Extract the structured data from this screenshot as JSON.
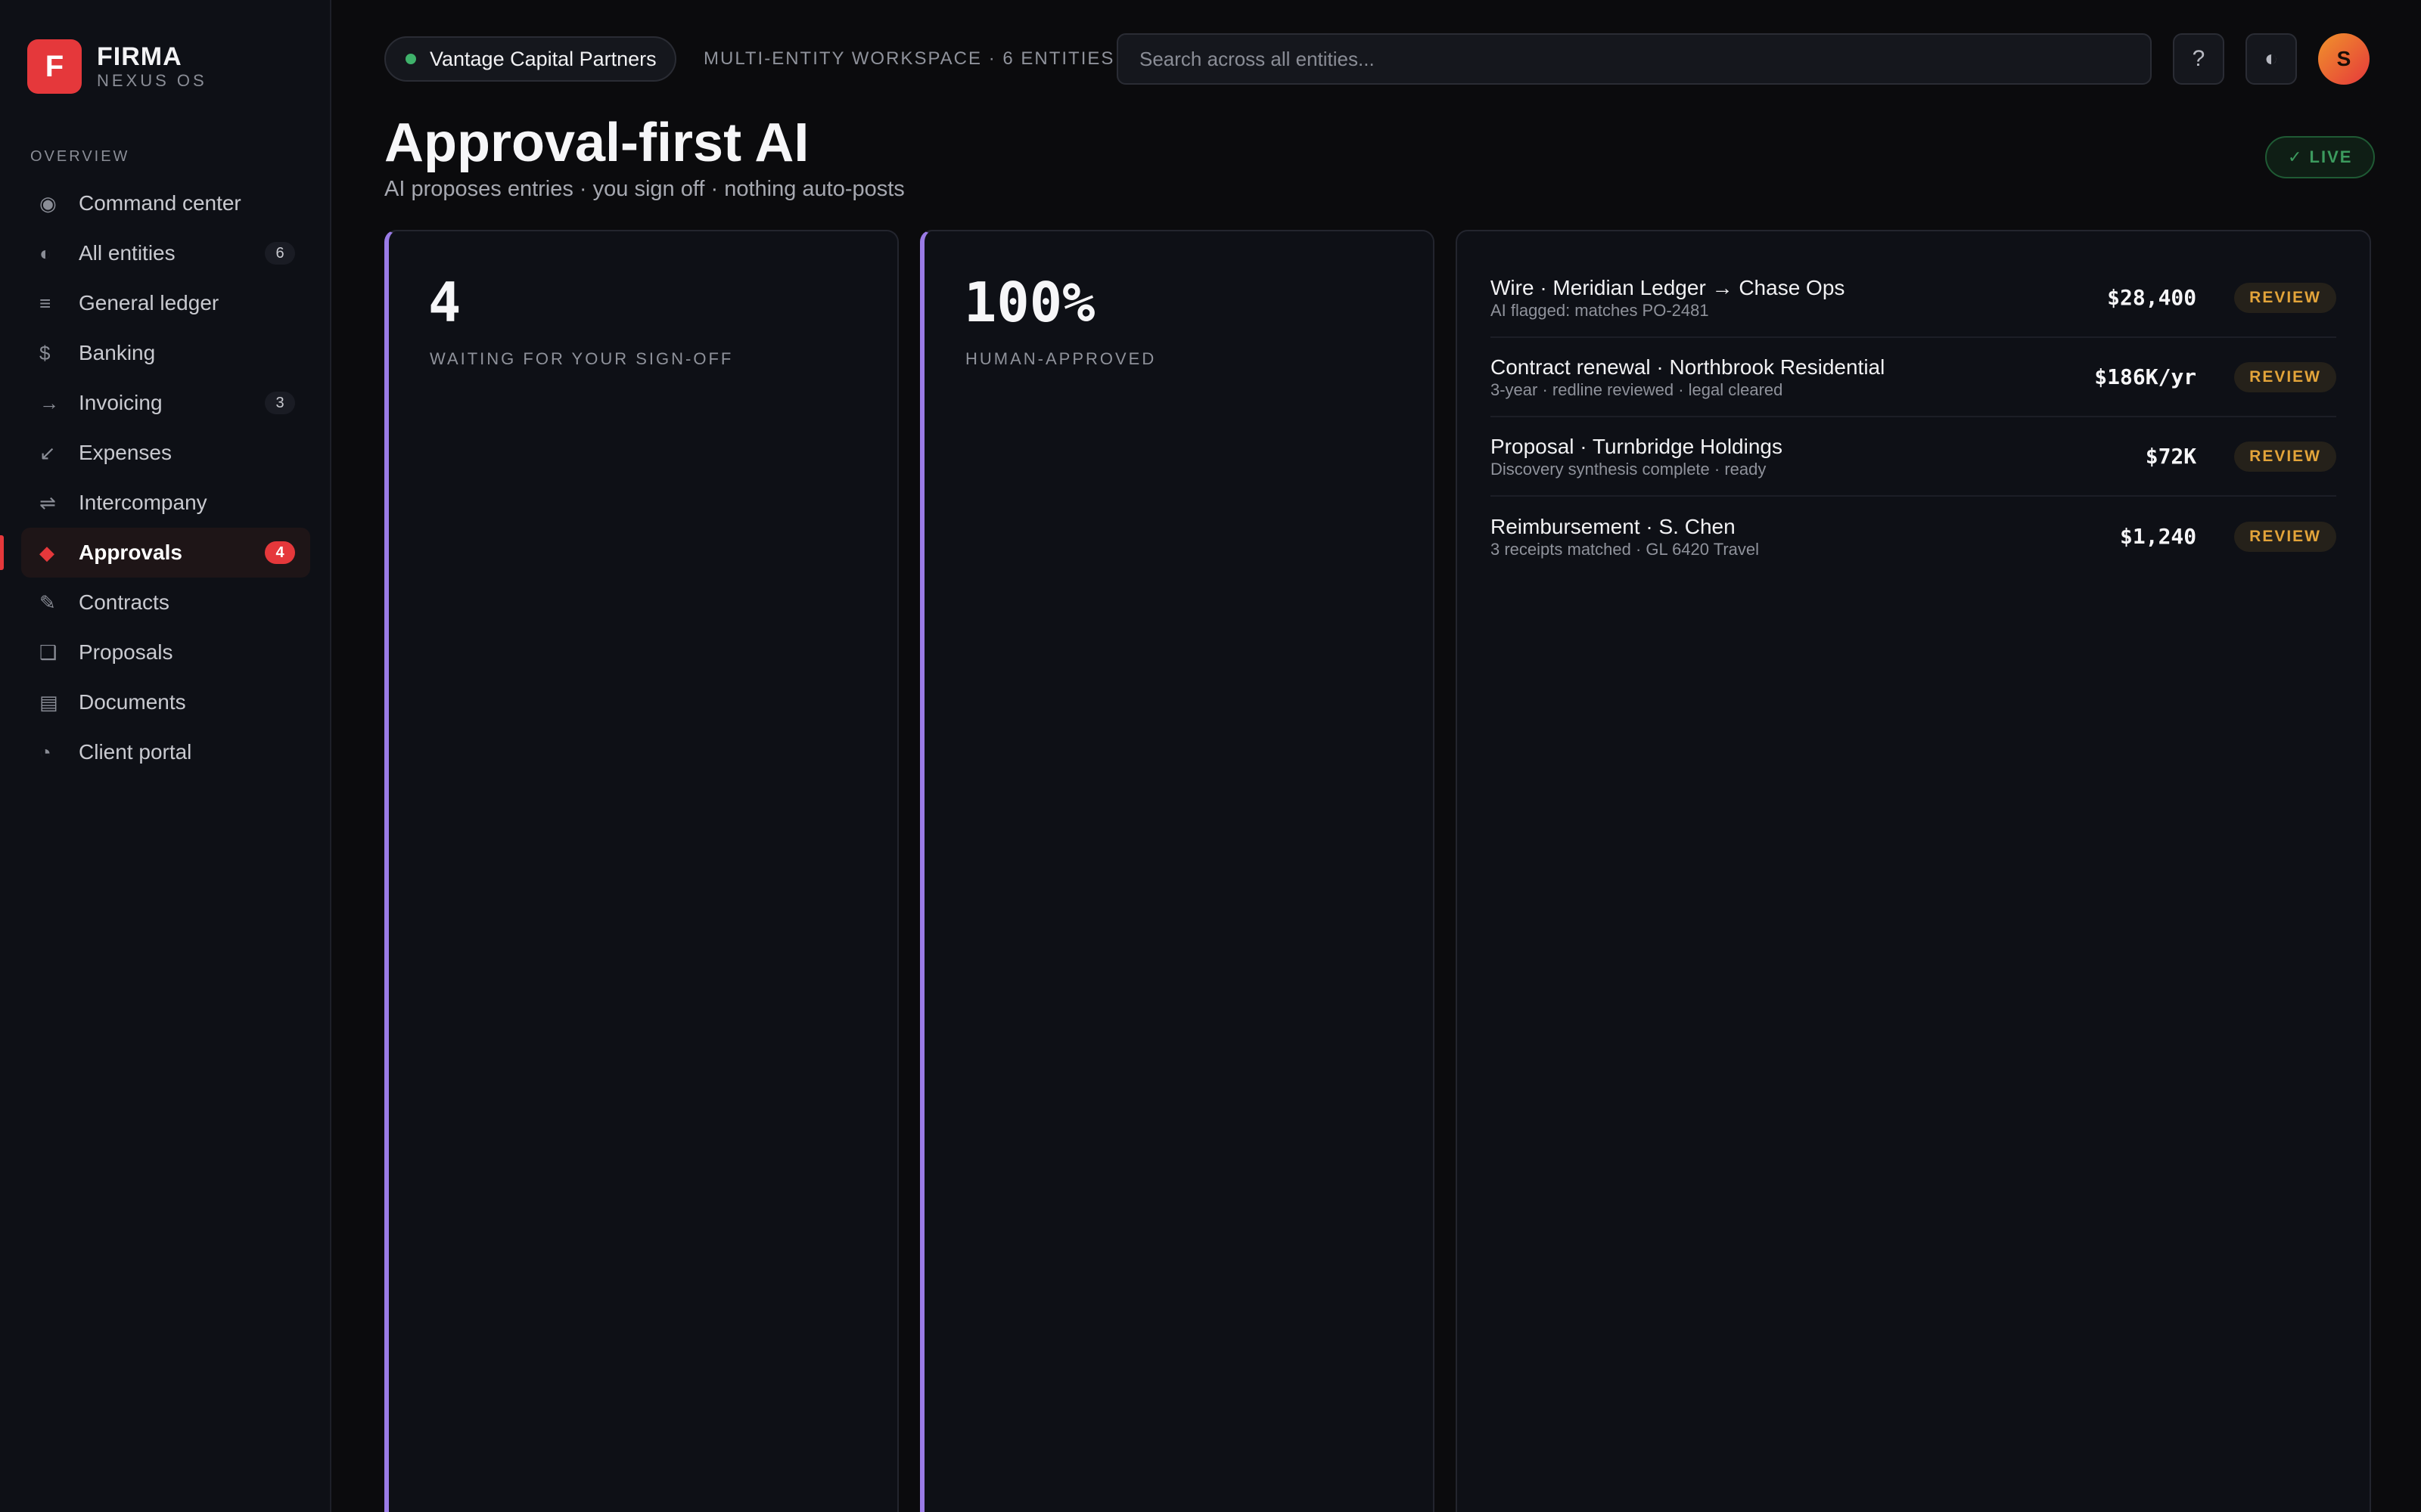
{
  "brand": {
    "logo_letter": "F",
    "name": "FIRMA",
    "subtitle": "NEXUS OS"
  },
  "sidebar": {
    "section_label": "OVERVIEW",
    "items": [
      {
        "label": "Command center",
        "icon": "target-icon",
        "glyph": "◉",
        "count": ""
      },
      {
        "label": "All entities",
        "icon": "half-circle-icon",
        "glyph": "◐",
        "count": "6"
      },
      {
        "label": "General ledger",
        "icon": "lines-icon",
        "glyph": "≡",
        "count": ""
      },
      {
        "label": "Banking",
        "icon": "dollar-icon",
        "glyph": "$",
        "count": ""
      },
      {
        "label": "Invoicing",
        "icon": "arrow-right-icon",
        "glyph": "→",
        "count": "3"
      },
      {
        "label": "Expenses",
        "icon": "arrow-down-left-icon",
        "glyph": "↙",
        "count": ""
      },
      {
        "label": "Intercompany",
        "icon": "swap-icon",
        "glyph": "⇌",
        "count": ""
      },
      {
        "label": "Approvals",
        "icon": "diamond-icon",
        "glyph": "◆",
        "count": "4",
        "active": true
      },
      {
        "label": "Contracts",
        "icon": "pen-icon",
        "glyph": "✎",
        "count": ""
      },
      {
        "label": "Proposals",
        "icon": "square-icon",
        "glyph": "❑",
        "count": ""
      },
      {
        "label": "Documents",
        "icon": "document-icon",
        "glyph": "▤",
        "count": ""
      },
      {
        "label": "Client portal",
        "icon": "pie-icon",
        "glyph": "◔",
        "count": ""
      }
    ]
  },
  "topbar": {
    "entity_name": "Vantage Capital Partners",
    "entity_status_color": "#3fb26b",
    "workspace_label": "MULTI-ENTITY WORKSPACE · 6 ENTITIES",
    "search_placeholder": "Search across all entities...",
    "help_glyph": "?",
    "theme_glyph": "◐",
    "avatar_initial": "S"
  },
  "page": {
    "title": "Approval-first AI",
    "subtitle": "AI proposes entries · you sign off · nothing auto-posts",
    "live_badge": "✓ LIVE"
  },
  "stats": [
    {
      "value": "4",
      "label": "WAITING FOR YOUR SIGN-OFF"
    },
    {
      "value": "100%",
      "label": "HUMAN-APPROVED"
    }
  ],
  "queue": [
    {
      "title": "Wire · Meridian Ledger → Chase Ops",
      "subtitle": "AI flagged: matches PO-2481",
      "amount": "$28,400",
      "status": "REVIEW"
    },
    {
      "title": "Contract renewal · Northbrook Residential",
      "subtitle": "3-year · redline reviewed · legal cleared",
      "amount": "$186K/yr",
      "status": "REVIEW"
    },
    {
      "title": "Proposal · Turnbridge Holdings",
      "subtitle": "Discovery synthesis complete · ready",
      "amount": "$72K",
      "status": "REVIEW"
    },
    {
      "title": "Reimbursement · S. Chen",
      "subtitle": "3 receipts matched · GL 6420 Travel",
      "amount": "$1,240",
      "status": "REVIEW"
    }
  ],
  "colors": {
    "accent": "#e5383b",
    "card_accent": "#9a7be6",
    "review": "#e3a43a",
    "live": "#3c9a5e"
  }
}
